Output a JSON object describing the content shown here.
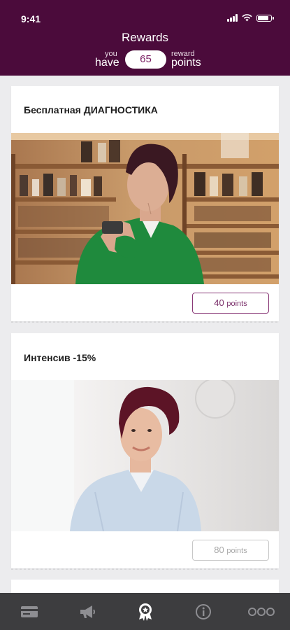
{
  "status_bar": {
    "time": "9:41"
  },
  "header": {
    "title": "Rewards",
    "you_label": "you",
    "have_label": "have",
    "points_value": "65",
    "reward_label": "reward",
    "points_label": "points"
  },
  "rewards": [
    {
      "title": "Бесплатная ДИАГНОСТИКА",
      "points": "40",
      "unit": "points",
      "available": true
    },
    {
      "title": "Интенсив -15%",
      "points": "80",
      "unit": "points",
      "available": false
    }
  ],
  "tabbar": {
    "items": [
      {
        "icon": "card-icon"
      },
      {
        "icon": "megaphone-icon"
      },
      {
        "icon": "award-icon",
        "active": true
      },
      {
        "icon": "info-icon"
      },
      {
        "icon": "more-icon"
      }
    ]
  },
  "colors": {
    "brand": "#4b0b3b",
    "accent": "#7a2f6a",
    "tabbar": "#3d3d3f",
    "background": "#ececee"
  }
}
